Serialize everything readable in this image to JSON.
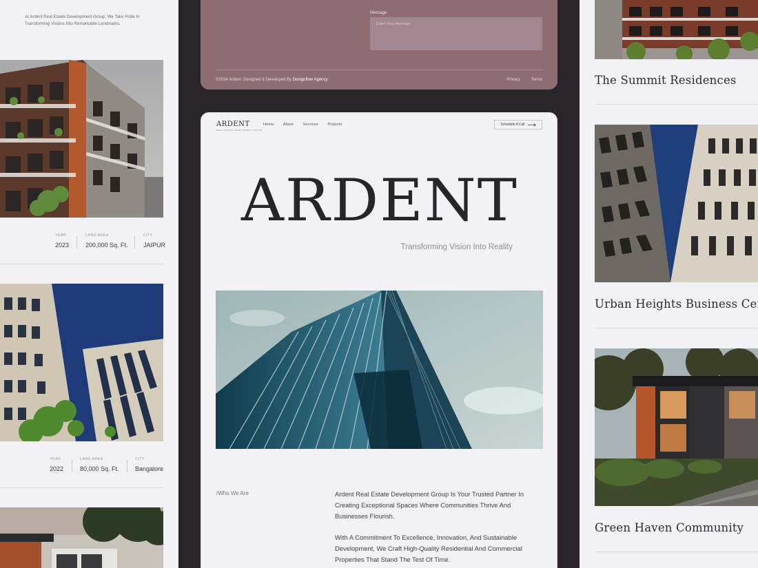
{
  "left": {
    "intro": "At Ardent Real Estate Development Group, We Take Pride In Transforming Visions Into Remarkable Landmarks.",
    "projects": [
      {
        "year_label": "YEAR",
        "year": "2023",
        "area_label": "LAND AREA",
        "area": "200,000 Sq. Ft.",
        "city_label": "CITY",
        "city": "JAIPUR"
      },
      {
        "year_label": "YEAR",
        "year": "2022",
        "area_label": "LAND AREA",
        "area": "80,000 Sq. Ft.",
        "city_label": "CITY",
        "city": "Bangalore"
      }
    ]
  },
  "contact": {
    "message_label": "Message",
    "message_placeholder": "Enter Your Message",
    "copyright": "©2024 Ardent. Designed & Developed By ",
    "agency": "Designflow Agency",
    "links": [
      "Privacy",
      "Terms"
    ]
  },
  "nav": {
    "logo": "ARDENT",
    "logo_sub": "REAL ESTATE DEVELOPMENT GROUP",
    "items": [
      "Home",
      "About",
      "Services",
      "Projects"
    ],
    "cta": "Schedule A Call"
  },
  "hero": {
    "title": "ARDENT",
    "tagline": "Transforming Vision Into Reality"
  },
  "about": {
    "label": "/Who We Are",
    "p1": "Ardent Real Estate Development Group Is Your Trusted Partner In Creating Exceptional Spaces Where Communities Thrive And Businesses Flourish.",
    "p2": "With A Commitment To Excellence, Innovation, And Sustainable Development, We Craft High-Quality Residential And Commercial Properties That Stand The Test Of Time."
  },
  "right": {
    "projects": [
      {
        "title": "The Summit Residences"
      },
      {
        "title": "Urban Heights Business Center"
      },
      {
        "title": "Green Haven Community"
      }
    ]
  },
  "colors": {
    "background": "#2a2528",
    "panel": "#f2f1f4",
    "contact_card": "#8d6c74",
    "text_dark": "#262529"
  }
}
